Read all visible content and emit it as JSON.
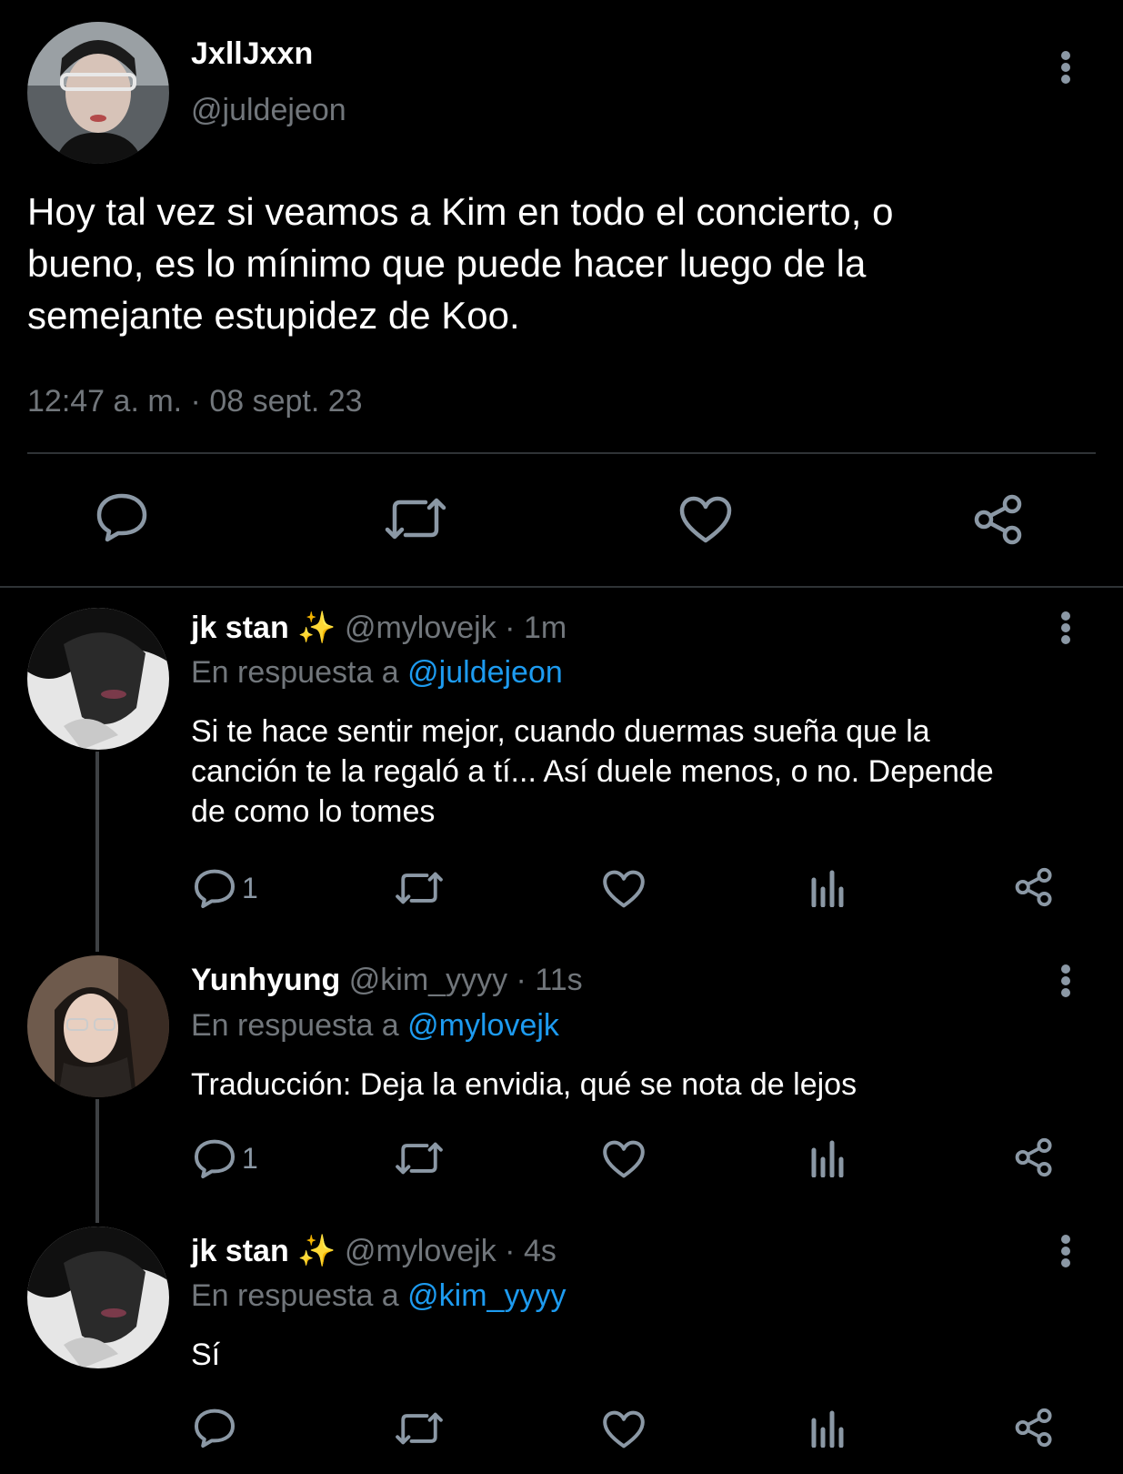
{
  "main_tweet": {
    "display_name": "JxllJxxn",
    "handle": "@juldejeon",
    "text_lines": [
      "Hoy tal vez si veamos a Kim en todo el concierto, o",
      "bueno, es lo mínimo que puede hacer luego de la",
      "semejante estupidez de Koo."
    ],
    "timestamp": "12:47 a. m. · 08 sept. 23",
    "actions": [
      "reply-icon",
      "retweet-icon",
      "like-icon",
      "share-icon"
    ]
  },
  "replies": [
    {
      "display_name": "jk stan",
      "emoji": "✨",
      "handle": "@mylovejk",
      "sep": " · ",
      "time": "1m",
      "reply_prefix": "En respuesta a ",
      "reply_to": "@juldejeon",
      "text_lines": [
        "Si te hace sentir mejor, cuando duermas sueña que la",
        "canción te la regaló a tí... Así duele menos, o no. Depende",
        "de como lo tomes"
      ],
      "reply_count": "1"
    },
    {
      "display_name": "Yunhyung",
      "emoji": "",
      "handle": "@kim_yyyy",
      "sep": " · ",
      "time": "11s",
      "reply_prefix": "En respuesta a ",
      "reply_to": "@mylovejk",
      "text_lines": [
        "Traducción: Deja la envidia, qué se nota de lejos"
      ],
      "reply_count": "1"
    },
    {
      "display_name": "jk stan",
      "emoji": "✨",
      "handle": "@mylovejk",
      "sep": " · ",
      "time": "4s",
      "reply_prefix": "En respuesta a ",
      "reply_to": "@kim_yyyy",
      "text_lines": [
        "Sí"
      ],
      "reply_count": ""
    }
  ],
  "colors": {
    "background": "#000000",
    "text": "#e7e9ea",
    "muted": "#71767b",
    "link": "#1d9bf0",
    "icon": "#8b98a5"
  }
}
